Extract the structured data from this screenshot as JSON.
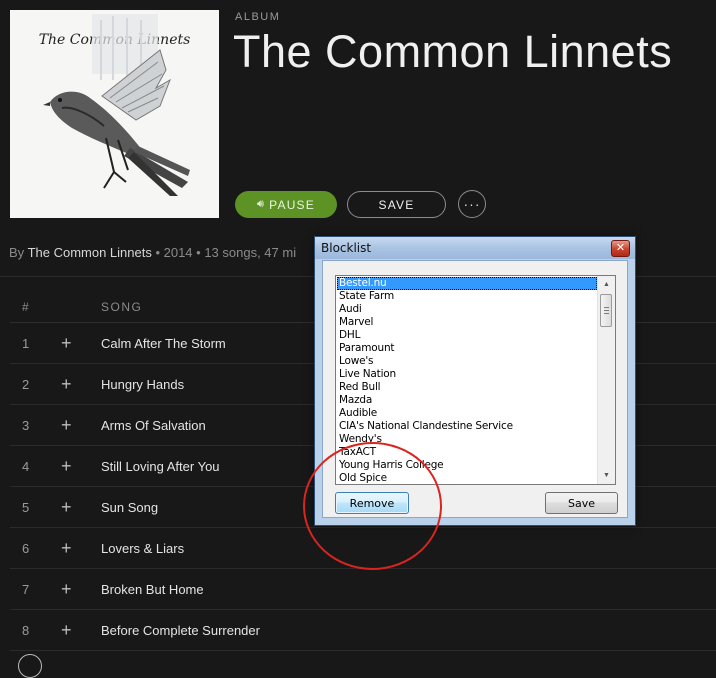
{
  "album": {
    "label": "ALBUM",
    "title": "The Common Linnets",
    "art_text": "The Common Linnets"
  },
  "controls": {
    "pause_label": "PAUSE",
    "save_label": "SAVE",
    "more_label": "···",
    "pause_color": "#5d9224"
  },
  "meta": {
    "by": "By",
    "artist": "The Common Linnets",
    "details": " • 2014 • 13 songs, 47 mi"
  },
  "tracklist": {
    "header_num": "#",
    "header_song": "SONG",
    "tracks": [
      {
        "num": "1",
        "name": "Calm After The Storm"
      },
      {
        "num": "2",
        "name": "Hungry Hands"
      },
      {
        "num": "3",
        "name": "Arms Of Salvation"
      },
      {
        "num": "4",
        "name": "Still Loving After You"
      },
      {
        "num": "5",
        "name": "Sun Song"
      },
      {
        "num": "6",
        "name": "Lovers & Liars"
      },
      {
        "num": "7",
        "name": "Broken But Home"
      },
      {
        "num": "8",
        "name": "Before Complete Surrender"
      }
    ]
  },
  "dialog": {
    "title": "Blocklist",
    "close_glyph": "✕",
    "selected_item": "Bestel.nu",
    "items": [
      "Bestel.nu",
      "State Farm",
      "Audi",
      "Marvel",
      "DHL",
      "Paramount",
      "Lowe's",
      "Live Nation",
      "Red Bull",
      "Mazda",
      "Audible",
      "CIA's National Clandestine Service",
      "Wendy's",
      "TaxACT",
      "Young Harris College",
      "Old Spice"
    ],
    "remove_label": "Remove",
    "save_label": "Save",
    "annotation_color": "#d9241f"
  }
}
